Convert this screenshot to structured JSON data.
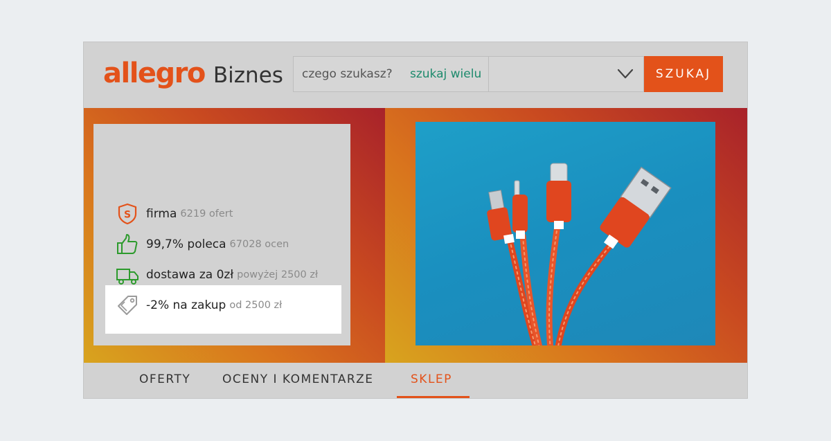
{
  "header": {
    "logo_brand": "allegro",
    "logo_suffix": "Biznes",
    "search_placeholder": "czego szukasz?",
    "search_many": "szukaj wielu",
    "search_button": "SZUKAJ"
  },
  "store": {
    "items": [
      {
        "icon": "super-seller-shield-icon",
        "main": "firma",
        "sub": "6219 ofert"
      },
      {
        "icon": "thumbs-up-icon",
        "main": "99,7% poleca",
        "sub": "67028 ocen"
      },
      {
        "icon": "delivery-truck-icon",
        "main": "dostawa za 0zł",
        "sub": "powyżej 2500 zł"
      },
      {
        "icon": "price-tag-icon",
        "main": "-2% na zakup",
        "sub": "od 2500 zł"
      }
    ]
  },
  "tabs": [
    {
      "label": "OFERTY",
      "active": false
    },
    {
      "label": "OCENY I KOMENTARZE",
      "active": false
    },
    {
      "label": "SKLEP",
      "active": true
    }
  ],
  "colors": {
    "brand": "#e3521a",
    "accent_green": "#1d8a6c",
    "icon_green": "#2c9a2c",
    "banner_orange": "#d9741d",
    "banner_red": "#a8222a",
    "photo_blue": "#1a8fbf"
  }
}
